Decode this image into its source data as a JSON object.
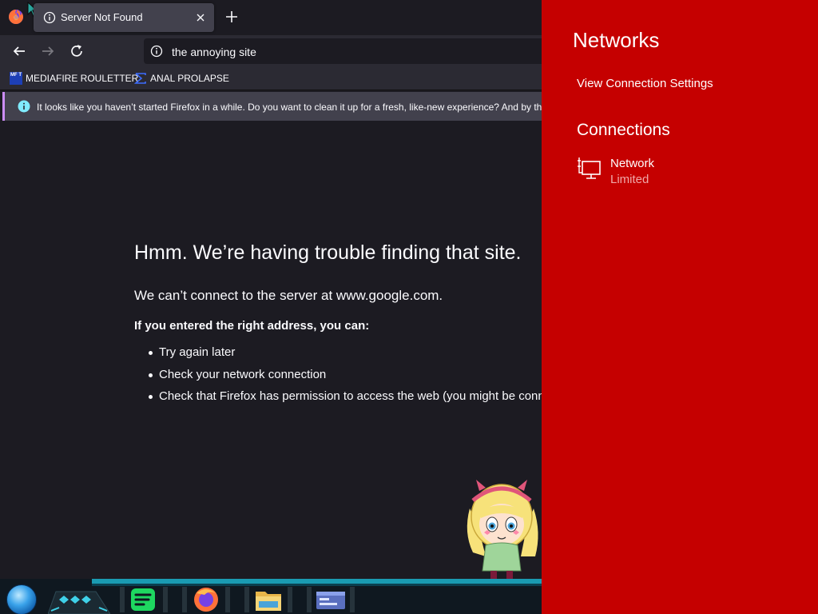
{
  "browser": {
    "tab": {
      "title": "Server Not Found"
    },
    "url": "the annoying site",
    "bookmarks": [
      {
        "icon_text": "MF T",
        "label": "MEDIAFIRE ROULETTER"
      },
      {
        "label": "ANAL PROLAPSE"
      }
    ],
    "notice": "It looks like you haven’t started Firefox in a while. Do you want to clean it up for a fresh, like-new experience? And by the way, welcome back!",
    "error": {
      "title": "Hmm. We’re having trouble finding that site.",
      "description": "We can’t connect to the server at www.google.com.",
      "subheading": "If you entered the right address, you can:",
      "suggestions": [
        "Try again later",
        "Check your network connection",
        "Check that Firefox has permission to access the web (you might be connected but behind a firewall)"
      ]
    }
  },
  "flyout": {
    "title": "Networks",
    "settings_link": "View Connection Settings",
    "section_title": "Connections",
    "network": {
      "name": "Network",
      "status": "Limited"
    }
  },
  "colors": {
    "flyout_bg": "#c50000",
    "browser_bg": "#1c1b22",
    "toolbar_bg": "#2b2a33",
    "notice_accent": "#cc8df8",
    "taskbar_rail": "#1a9bb2"
  },
  "icons": {
    "tab": "info-icon",
    "tab_close": "close-icon",
    "new_tab": "plus-icon",
    "nav": [
      "back-arrow-icon",
      "forward-arrow-icon",
      "reload-icon"
    ],
    "flyout_network": "wired-network-icon",
    "taskbar": [
      "start-orb-icon",
      "spotify-icon",
      "firefox-icon",
      "file-explorer-icon",
      "terminal-icon"
    ]
  }
}
